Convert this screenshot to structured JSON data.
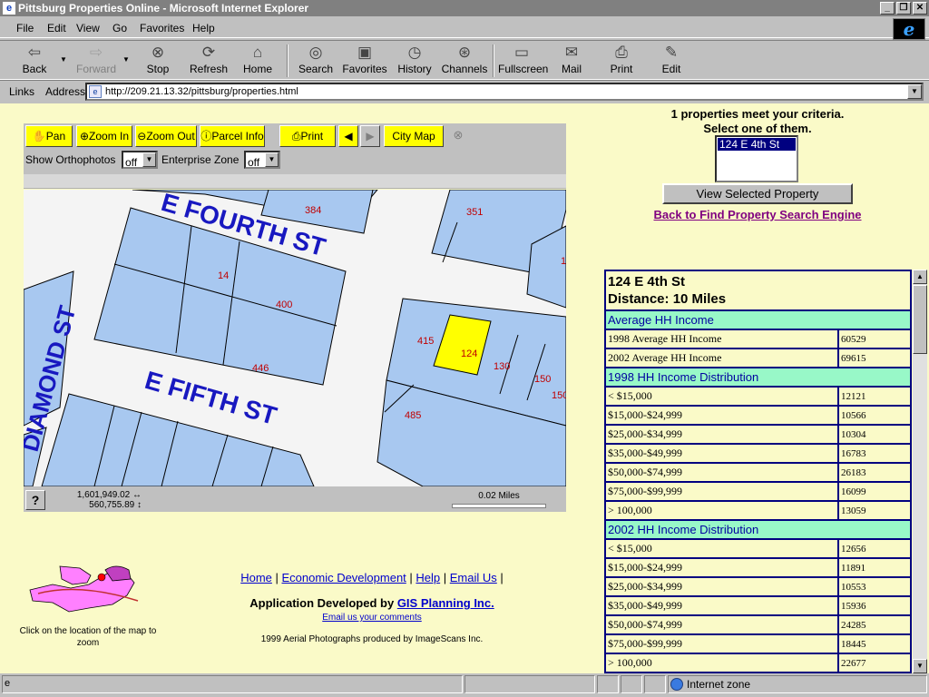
{
  "window": {
    "title": "Pittsburg Properties Online - Microsoft Internet Explorer"
  },
  "menu": [
    "File",
    "Edit",
    "View",
    "Go",
    "Favorites",
    "Help"
  ],
  "toolbar": [
    {
      "label": "Back",
      "icon": "back-arrow-icon"
    },
    {
      "label": "Forward",
      "icon": "forward-arrow-icon"
    },
    {
      "label": "Stop",
      "icon": "stop-icon"
    },
    {
      "label": "Refresh",
      "icon": "refresh-icon"
    },
    {
      "label": "Home",
      "icon": "home-icon"
    },
    {
      "label": "Search",
      "icon": "search-icon"
    },
    {
      "label": "Favorites",
      "icon": "favorites-icon"
    },
    {
      "label": "History",
      "icon": "history-icon"
    },
    {
      "label": "Channels",
      "icon": "channels-icon"
    },
    {
      "label": "Fullscreen",
      "icon": "fullscreen-icon"
    },
    {
      "label": "Mail",
      "icon": "mail-icon"
    },
    {
      "label": "Print",
      "icon": "print-icon"
    },
    {
      "label": "Edit",
      "icon": "edit-icon"
    }
  ],
  "address": {
    "links_label": "Links",
    "address_label": "Address",
    "url": "http://209.21.13.32/pittsburg/properties.html"
  },
  "map_tools": {
    "pan": "Pan",
    "zoom_in": "Zoom In",
    "zoom_out": "Zoom Out",
    "parcel_info": "Parcel Info",
    "print": "Print",
    "city_map": "City Map",
    "orthophotos_label": "Show Orthophotos",
    "orthophotos_value": "off",
    "enterprise_label": "Enterprise Zone",
    "enterprise_value": "off"
  },
  "map": {
    "streets": [
      "E FOURTH ST",
      "E FIFTH ST",
      "DIAMOND ST"
    ],
    "parcels": [
      {
        "label": "384",
        "highlight": false
      },
      {
        "label": "351",
        "highlight": false
      },
      {
        "label": "14",
        "highlight": false
      },
      {
        "label": "400",
        "highlight": false
      },
      {
        "label": "446",
        "highlight": false
      },
      {
        "label": "415",
        "highlight": false
      },
      {
        "label": "124",
        "highlight": true
      },
      {
        "label": "130",
        "highlight": false
      },
      {
        "label": "150",
        "highlight": false
      },
      {
        "label": "150",
        "highlight": false
      },
      {
        "label": "485",
        "highlight": false
      },
      {
        "label": "1",
        "highlight": false
      }
    ],
    "help": "?",
    "coord_x": "1,601,949.02",
    "coord_y": "560,755.89",
    "scale": "0.02 Miles"
  },
  "inset_caption": "Click on the location of the map to zoom",
  "footer": {
    "links": [
      "Home",
      "Economic Development",
      "Help",
      "Email Us"
    ],
    "developed_prefix": "Application Developed by",
    "developer": "GIS Planning Inc.",
    "email_comments": "Email us your comments",
    "aerial": "1999 Aerial Photographs produced by ImageScans Inc."
  },
  "results": {
    "count_line": "1 properties meet your criteria.",
    "select_line": "Select one of them.",
    "options": [
      "124 E 4th St"
    ],
    "view_button": "View Selected Property",
    "back_link": "Back to Find Property Search Engine"
  },
  "property": {
    "address": "124 E 4th St",
    "distance": "Distance: 10 Miles",
    "sections": [
      {
        "title": "Average HH Income",
        "rows": [
          {
            "label": "1998 Average HH Income",
            "value": "60529"
          },
          {
            "label": "2002 Average HH Income",
            "value": "69615"
          }
        ]
      },
      {
        "title": "1998 HH Income Distribution",
        "rows": [
          {
            "label": "< $15,000",
            "value": "12121"
          },
          {
            "label": "$15,000-$24,999",
            "value": "10566"
          },
          {
            "label": "$25,000-$34,999",
            "value": "10304"
          },
          {
            "label": "$35,000-$49,999",
            "value": "16783"
          },
          {
            "label": "$50,000-$74,999",
            "value": "26183"
          },
          {
            "label": "$75,000-$99,999",
            "value": "16099"
          },
          {
            "label": "> 100,000",
            "value": "13059"
          }
        ]
      },
      {
        "title": "2002 HH Income Distribution",
        "rows": [
          {
            "label": "< $15,000",
            "value": "12656"
          },
          {
            "label": "$15,000-$24,999",
            "value": "11891"
          },
          {
            "label": "$25,000-$34,999",
            "value": "10553"
          },
          {
            "label": "$35,000-$49,999",
            "value": "15936"
          },
          {
            "label": "$50,000-$74,999",
            "value": "24285"
          },
          {
            "label": "$75,000-$99,999",
            "value": "18445"
          },
          {
            "label": "> 100,000",
            "value": "22677"
          }
        ]
      }
    ]
  },
  "status": {
    "zone": "Internet zone"
  }
}
